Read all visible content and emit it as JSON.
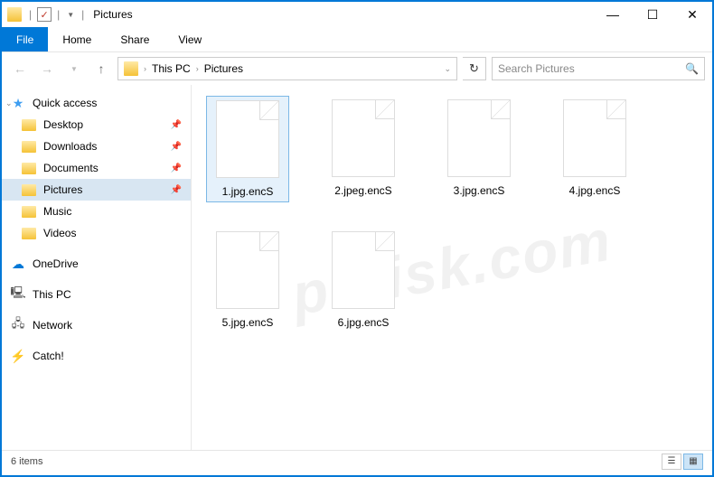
{
  "titlebar": {
    "title": "Pictures"
  },
  "ribbon": {
    "file": "File",
    "tabs": [
      "Home",
      "Share",
      "View"
    ]
  },
  "breadcrumb": {
    "root": "This PC",
    "current": "Pictures"
  },
  "search": {
    "placeholder": "Search Pictures"
  },
  "sidebar": {
    "quick_access": "Quick access",
    "quick_items": [
      {
        "label": "Desktop",
        "pinned": true
      },
      {
        "label": "Downloads",
        "pinned": true
      },
      {
        "label": "Documents",
        "pinned": true
      },
      {
        "label": "Pictures",
        "pinned": true,
        "selected": true
      },
      {
        "label": "Music",
        "pinned": false
      },
      {
        "label": "Videos",
        "pinned": false
      }
    ],
    "onedrive": "OneDrive",
    "thispc": "This PC",
    "network": "Network",
    "catch": "Catch!"
  },
  "files": [
    {
      "label": "1.jpg.encS",
      "selected": true
    },
    {
      "label": "2.jpeg.encS"
    },
    {
      "label": "3.jpg.encS"
    },
    {
      "label": "4.jpg.encS"
    },
    {
      "label": "5.jpg.encS"
    },
    {
      "label": "6.jpg.encS"
    }
  ],
  "statusbar": {
    "count": "6 items"
  },
  "watermark": "pcrisk.com"
}
